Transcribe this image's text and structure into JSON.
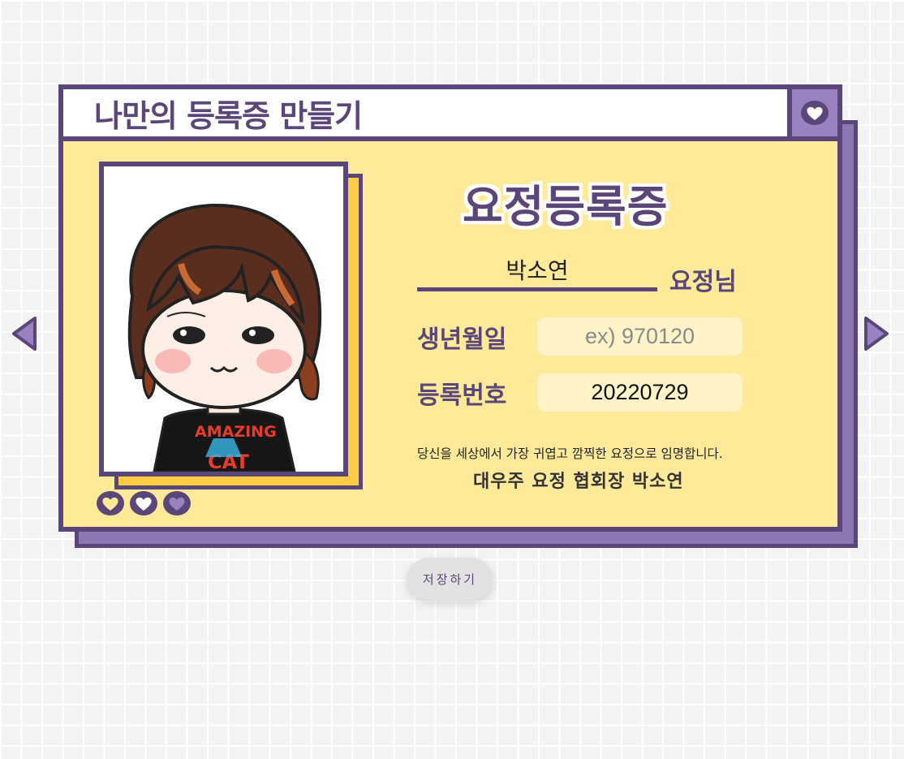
{
  "header": {
    "title": "나만의 등록증 만들기",
    "heart_icon": "heart-icon"
  },
  "card": {
    "heading": "요정등록증",
    "name_value": "박소연",
    "name_suffix": "요정님",
    "birth": {
      "label": "생년월일",
      "placeholder": "ex) 970120",
      "value": ""
    },
    "reg_no": {
      "label": "등록번호",
      "value": "20220729"
    },
    "statement": "당신을 세상에서 가장 귀엽고 깜찍한 요정으로 임명합니다.",
    "signer": "대우주 요정 협회장 박소연",
    "hearts": [
      "heart-icon",
      "heart-icon",
      "heart-icon"
    ],
    "photo_shirt_text": [
      "AMAZING",
      "CAT"
    ]
  },
  "navigation": {
    "prev_icon": "triangle-left-icon",
    "next_icon": "triangle-right-icon"
  },
  "actions": {
    "save_label": "저장하기"
  },
  "colors": {
    "purple": "#5a4678",
    "light_purple": "#9a82c0",
    "card_yellow": "#ffea99",
    "photo_frame_yellow": "#ffcc44",
    "field_bg": "#fff3c7"
  }
}
